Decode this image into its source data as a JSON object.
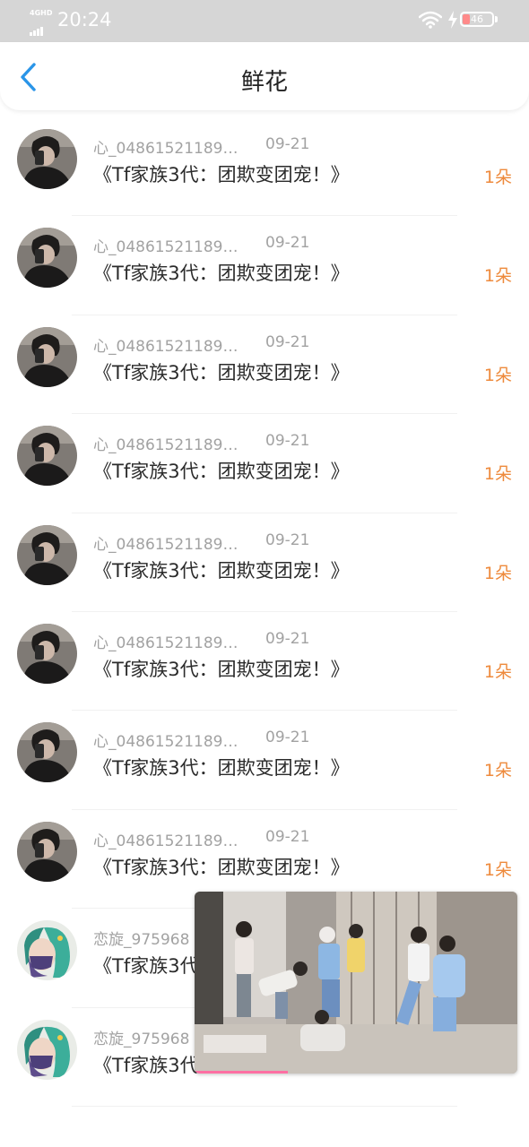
{
  "status_bar": {
    "network": "4GHD",
    "time": "20:24",
    "battery": "46"
  },
  "header": {
    "title": "鲜花",
    "back_icon": "chevron-left-icon"
  },
  "colors": {
    "accent_blue": "#2a95e8",
    "count_orange": "#ee8a3c",
    "meta_gray": "#a2a2a2",
    "status_bar_bg": "#d6d6d6"
  },
  "flowers": [
    {
      "name": "心_04861521189…",
      "date": "09-21",
      "title": "《Tf家族3代：团欺变团宠！》",
      "count": "1朵",
      "avatar": "dark-portrait"
    },
    {
      "name": "心_04861521189…",
      "date": "09-21",
      "title": "《Tf家族3代：团欺变团宠！》",
      "count": "1朵",
      "avatar": "dark-portrait"
    },
    {
      "name": "心_04861521189…",
      "date": "09-21",
      "title": "《Tf家族3代：团欺变团宠！》",
      "count": "1朵",
      "avatar": "dark-portrait"
    },
    {
      "name": "心_04861521189…",
      "date": "09-21",
      "title": "《Tf家族3代：团欺变团宠！》",
      "count": "1朵",
      "avatar": "dark-portrait"
    },
    {
      "name": "心_04861521189…",
      "date": "09-21",
      "title": "《Tf家族3代：团欺变团宠！》",
      "count": "1朵",
      "avatar": "dark-portrait"
    },
    {
      "name": "心_04861521189…",
      "date": "09-21",
      "title": "《Tf家族3代：团欺变团宠！》",
      "count": "1朵",
      "avatar": "dark-portrait"
    },
    {
      "name": "心_04861521189…",
      "date": "09-21",
      "title": "《Tf家族3代：团欺变团宠！》",
      "count": "1朵",
      "avatar": "dark-portrait"
    },
    {
      "name": "心_04861521189…",
      "date": "09-21",
      "title": "《Tf家族3代：团欺变团宠！》",
      "count": "1朵",
      "avatar": "dark-portrait"
    },
    {
      "name": "恋旋_975968",
      "date": "",
      "title": "《Tf家族3代",
      "count": "",
      "avatar": "anime-portrait"
    },
    {
      "name": "恋旋_975968",
      "date": "",
      "title": "《Tf家族3代",
      "count": "",
      "avatar": "anime-portrait"
    }
  ],
  "video_overlay": {
    "kind": "floating-video-player",
    "progress_fraction": 0.29
  }
}
